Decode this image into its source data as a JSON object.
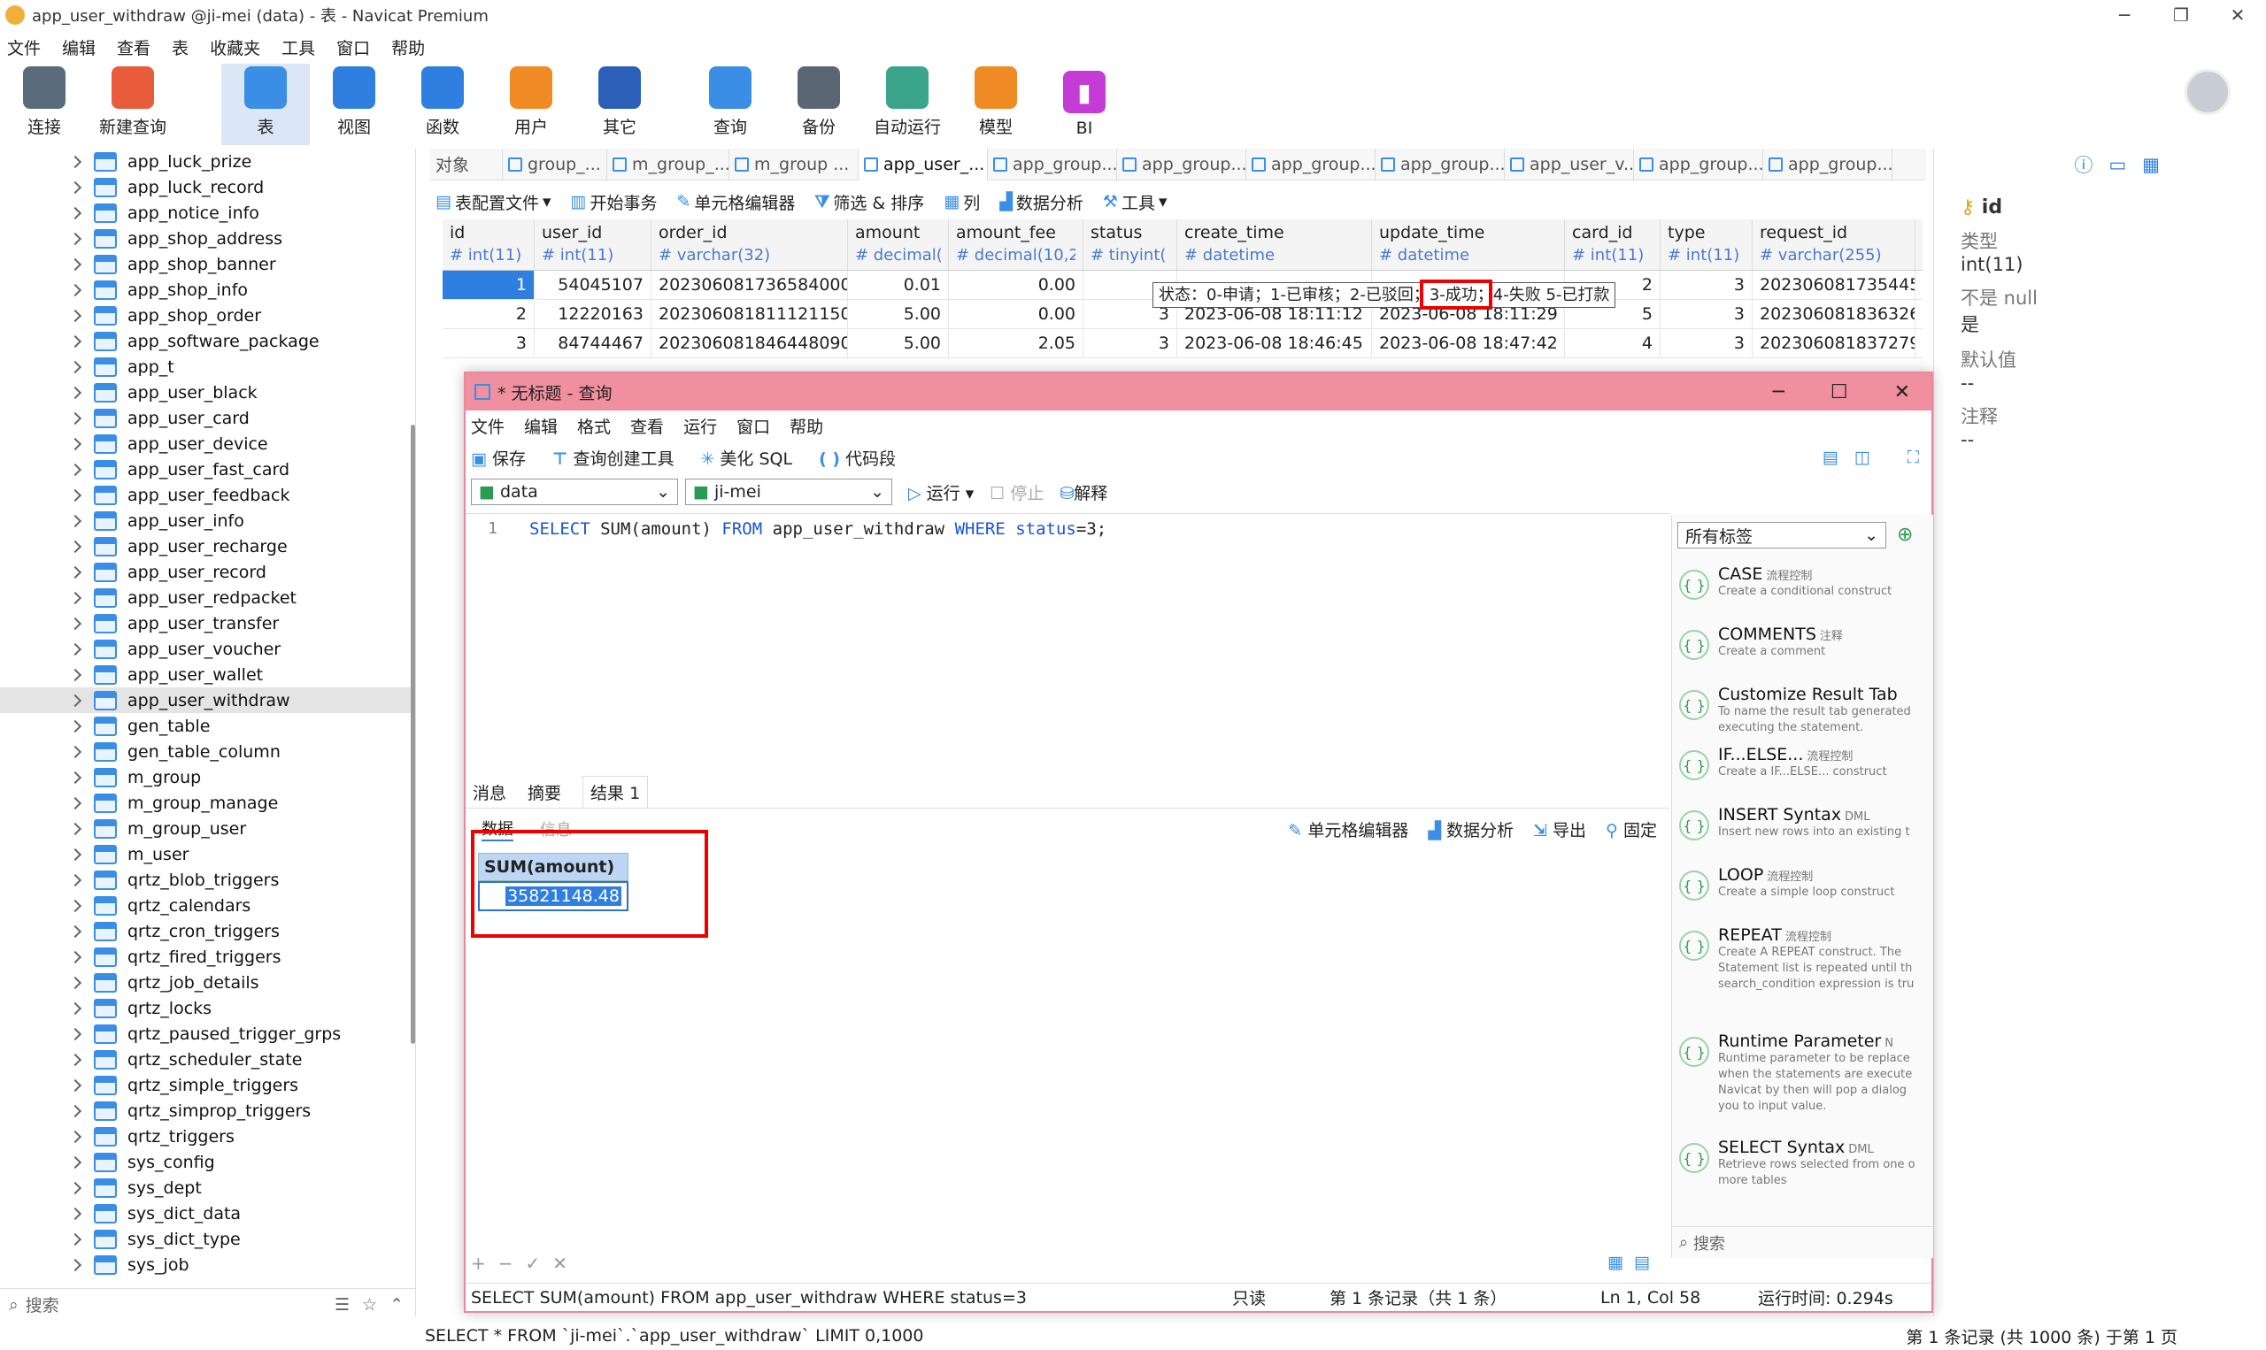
{
  "window": {
    "title": "app_user_withdraw @ji-mei (data) - 表 - Navicat Premium"
  },
  "menu": [
    "文件",
    "编辑",
    "查看",
    "表",
    "收藏夹",
    "工具",
    "窗口",
    "帮助"
  ],
  "toolbar": [
    {
      "label": "连接",
      "icon": "plug-icon",
      "color": "#5a6b7c"
    },
    {
      "label": "新建查询",
      "icon": "new-query-icon",
      "color": "#e85c3b"
    },
    {
      "label": "表",
      "icon": "table-icon",
      "color": "#3a8ee6",
      "active": true
    },
    {
      "label": "视图",
      "icon": "view-icon",
      "color": "#2f7fe0"
    },
    {
      "label": "函数",
      "icon": "function-icon",
      "color": "#2f7fe0"
    },
    {
      "label": "用户",
      "icon": "user-icon",
      "color": "#f08a24"
    },
    {
      "label": "其它",
      "icon": "tools-icon",
      "color": "#2c5fb8"
    },
    {
      "label": "查询",
      "icon": "query-icon",
      "color": "#3a8ee6"
    },
    {
      "label": "备份",
      "icon": "backup-icon",
      "color": "#5a6673"
    },
    {
      "label": "自动运行",
      "icon": "robot-icon",
      "color": "#3aa58a"
    },
    {
      "label": "模型",
      "icon": "model-icon",
      "color": "#f08a24"
    },
    {
      "label": "BI",
      "icon": "bi-icon",
      "color": "#c53bd6"
    }
  ],
  "tree": [
    "app_luck_prize",
    "app_luck_record",
    "app_notice_info",
    "app_shop_address",
    "app_shop_banner",
    "app_shop_info",
    "app_shop_order",
    "app_software_package",
    "app_t",
    "app_user_black",
    "app_user_card",
    "app_user_device",
    "app_user_fast_card",
    "app_user_feedback",
    "app_user_info",
    "app_user_recharge",
    "app_user_record",
    "app_user_redpacket",
    "app_user_transfer",
    "app_user_voucher",
    "app_user_wallet",
    "app_user_withdraw",
    "gen_table",
    "gen_table_column",
    "m_group",
    "m_group_manage",
    "m_group_user",
    "m_user",
    "qrtz_blob_triggers",
    "qrtz_calendars",
    "qrtz_cron_triggers",
    "qrtz_fired_triggers",
    "qrtz_job_details",
    "qrtz_locks",
    "qrtz_paused_trigger_grps",
    "qrtz_scheduler_state",
    "qrtz_simple_triggers",
    "qrtz_simprop_triggers",
    "qrtz_triggers",
    "sys_config",
    "sys_dept",
    "sys_dict_data",
    "sys_dict_type",
    "sys_job"
  ],
  "tree_selected": "app_user_withdraw",
  "left_search": "搜索",
  "obj_tabs": [
    "对象",
    "group_...",
    "m_group_...",
    "m_group ...",
    "app_user_...",
    "app_group...",
    "app_group...",
    "app_group...",
    "app_group...",
    "app_user_v...",
    "app_group...",
    "app_group..."
  ],
  "table_tools": [
    "表配置文件",
    "开始事务",
    "单元格编辑器",
    "筛选 & 排序",
    "列",
    "数据分析",
    "工具"
  ],
  "grid": {
    "columns": [
      {
        "name": "id",
        "type": "int(11)"
      },
      {
        "name": "user_id",
        "type": "int(11)"
      },
      {
        "name": "order_id",
        "type": "varchar(32)"
      },
      {
        "name": "amount",
        "type": "decimal("
      },
      {
        "name": "amount_fee",
        "type": "decimal(10,2"
      },
      {
        "name": "status",
        "type": "tinyint("
      },
      {
        "name": "create_time",
        "type": "datetime"
      },
      {
        "name": "update_time",
        "type": "datetime"
      },
      {
        "name": "card_id",
        "type": "int(11)"
      },
      {
        "name": "type",
        "type": "int(11)"
      },
      {
        "name": "request_id",
        "type": "varchar(255)"
      }
    ],
    "rows": [
      [
        "1",
        "54045107",
        "2023060817365840001",
        "0.01",
        "0.00",
        "",
        "",
        "",
        "2",
        "3",
        "2023060817354457"
      ],
      [
        "2",
        "12220163",
        "2023060818111211501",
        "5.00",
        "0.00",
        "3",
        "2023-06-08 18:11:12",
        "2023-06-08 18:11:29",
        "5",
        "3",
        "2023060818363265"
      ],
      [
        "3",
        "84744467",
        "2023060818464480901",
        "5.00",
        "2.05",
        "3",
        "2023-06-08 18:46:45",
        "2023-06-08 18:47:42",
        "4",
        "3",
        "2023060818372799"
      ]
    ],
    "tooltip": "状态：0-申请；1-已审核；2-已驳回；3-成功；4-失败 5-已打款"
  },
  "right_panel": {
    "field": "id",
    "type_label": "类型",
    "type_value": "int(11)",
    "null_label": "不是 null",
    "null_value": "是",
    "default_label": "默认值",
    "default_value": "--",
    "comment_label": "注释",
    "comment_value": "--"
  },
  "query": {
    "title": "* 无标题 - 查询",
    "menu": [
      "文件",
      "编辑",
      "格式",
      "查看",
      "运行",
      "窗口",
      "帮助"
    ],
    "tools": [
      "保存",
      "查询创建工具",
      "美化 SQL",
      "代码段"
    ],
    "db": "data",
    "schema": "ji-mei",
    "run": "运行",
    "stop": "停止",
    "explain": "解释",
    "line": "1",
    "sql": "SELECT SUM(amount) FROM app_user_withdraw WHERE status=3;",
    "result_tabs": [
      "消息",
      "摘要",
      "结果 1"
    ],
    "sub_tabs": [
      "数据",
      "信息"
    ],
    "result_tools": [
      "单元格编辑器",
      "数据分析",
      "导出",
      "固定"
    ],
    "result_header": "SUM(amount)",
    "result_value": "35821148.48",
    "status": {
      "sql": "SELECT SUM(amount) FROM app_user_withdraw WHERE status=3",
      "mode": "只读",
      "record": "第 1 条记录（共 1 条）",
      "pos": "Ln 1, Col 58",
      "time": "运行时间: 0.294s"
    }
  },
  "snippets": {
    "filter": "所有标签",
    "search": "搜索",
    "items": [
      {
        "title": "CASE",
        "tag": "流程控制",
        "desc": "Create a conditional construct"
      },
      {
        "title": "COMMENTS",
        "tag": "注释",
        "desc": "Create a comment"
      },
      {
        "title": "Customize Result Tab",
        "tag": "",
        "desc": "To name the result tab generated executing the statement."
      },
      {
        "title": "IF...ELSE...",
        "tag": "流程控制",
        "desc": "Create a IF...ELSE... construct"
      },
      {
        "title": "INSERT Syntax",
        "tag": "DML",
        "desc": "Insert new rows into an existing t"
      },
      {
        "title": "LOOP",
        "tag": "流程控制",
        "desc": "Create a simple loop construct"
      },
      {
        "title": "REPEAT",
        "tag": "流程控制",
        "desc": "Create A REPEAT construct. The Statement list is repeated until th search_condition expression is tru"
      },
      {
        "title": "Runtime Parameter",
        "tag": "N",
        "desc": "Runtime parameter to be replace when the statements are execute Navicat by then will pop a dialog you to input value."
      },
      {
        "title": "SELECT Syntax",
        "tag": "DML",
        "desc": "Retrieve rows selected from one o more tables"
      }
    ]
  },
  "main_status": {
    "sql": "SELECT * FROM `ji-mei`.`app_user_withdraw` LIMIT 0,1000",
    "record": "第 1 条记录 (共 1000 条) 于第 1 页"
  }
}
